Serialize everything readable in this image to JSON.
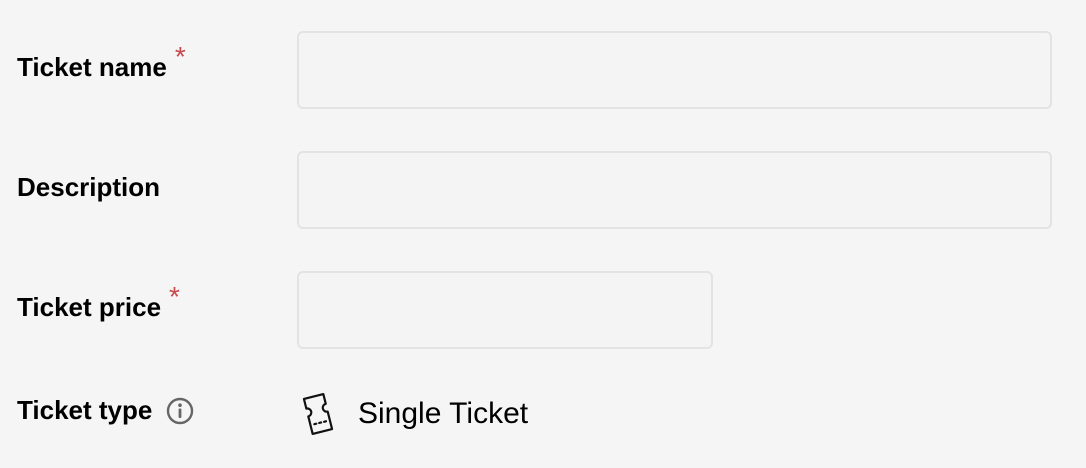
{
  "form": {
    "ticket_name": {
      "label": "Ticket name",
      "required_mark": "*",
      "value": "",
      "placeholder": ""
    },
    "description": {
      "label": "Description",
      "value": "",
      "placeholder": ""
    },
    "ticket_price": {
      "label": "Ticket price",
      "required_mark": "*",
      "value": "",
      "placeholder": ""
    },
    "ticket_type": {
      "label": "Ticket type",
      "info_icon": "info-icon",
      "value_icon": "ticket-icon",
      "value": "Single Ticket"
    }
  },
  "colors": {
    "background": "#f5f5f5",
    "required": "#c8494d",
    "border": "#e3e3e3",
    "icon": "#666666"
  }
}
